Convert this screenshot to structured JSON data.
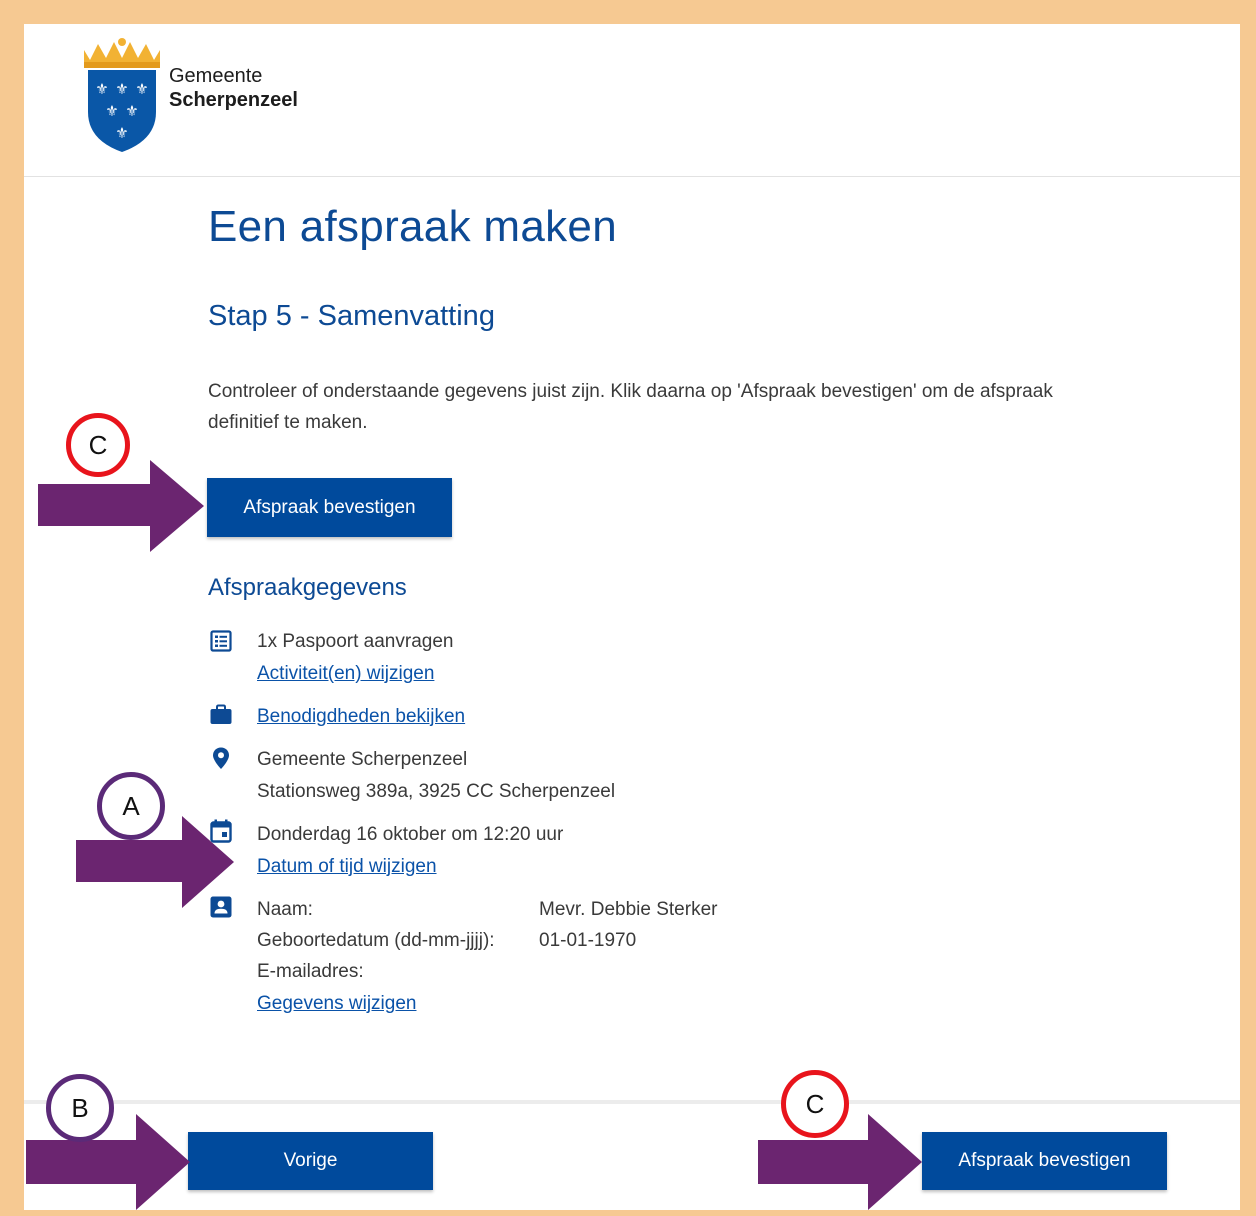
{
  "brand": {
    "line1": "Gemeente",
    "line2": "Scherpenzeel"
  },
  "page": {
    "title": "Een afspraak maken",
    "step": "Stap 5 - Samenvatting",
    "intro_line1": "Controleer of onderstaande gegevens juist zijn. Klik daarna op 'Afspraak bevestigen' om de afspraak",
    "intro_line2": "definitief te maken."
  },
  "buttons": {
    "confirm": "Afspraak bevestigen",
    "previous": "Vorige"
  },
  "details": {
    "section_title": "Afspraakgegevens",
    "activity": "1x Paspoort aanvragen",
    "activity_link": "Activiteit(en) wijzigen",
    "requirements_link": "Benodigdheden bekijken",
    "location_name": "Gemeente Scherpenzeel",
    "location_address": "Stationsweg 389a, 3925 CC Scherpenzeel",
    "datetime": "Donderdag 16 oktober om 12:20 uur",
    "datetime_link": "Datum of tijd wijzigen",
    "name_label": "Naam:",
    "name_value": "Mevr. Debbie Sterker",
    "dob_label": "Geboortedatum (dd-mm-jjjj):",
    "dob_value": "01-01-1970",
    "email_label": "E-mailadres:",
    "personal_link": "Gegevens wijzigen"
  },
  "annotations": {
    "a": "A",
    "b": "B",
    "c_top": "C",
    "c_bottom": "C"
  },
  "colors": {
    "primary": "#004a9c",
    "heading": "#0d4a94",
    "link": "#0a52a8",
    "frame": "#f6c992",
    "arrow": "#6b2570",
    "badge_red": "#e8141c",
    "badge_purple": "#5b2a78"
  },
  "icons": {
    "activity": "list-icon",
    "requirements": "briefcase-icon",
    "location": "map-pin-icon",
    "date": "calendar-icon",
    "person": "contact-card-icon"
  }
}
